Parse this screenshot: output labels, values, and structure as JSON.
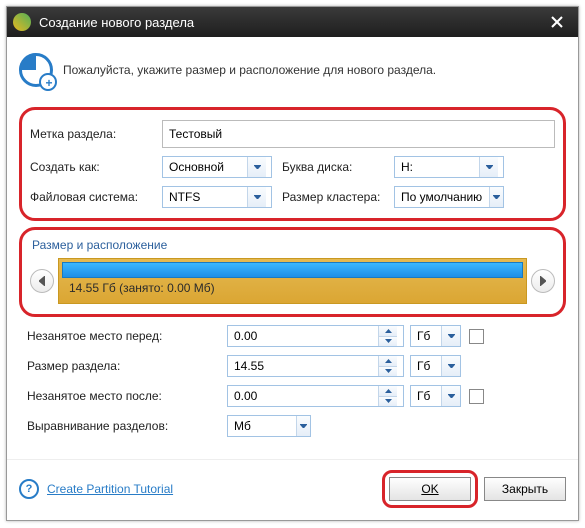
{
  "title": "Создание нового раздела",
  "intro": "Пожалуйста, укажите размер и расположение для нового раздела.",
  "labels": {
    "partition_label": "Метка раздела:",
    "create_as": "Создать как:",
    "drive_letter": "Буква диска:",
    "file_system": "Файловая система:",
    "cluster_size": "Размер кластера:",
    "group_title": "Размер и расположение",
    "free_before": "Незанятое место перед:",
    "partition_size": "Размер раздела:",
    "free_after": "Незанятое место после:",
    "alignment": "Выравнивание разделов:"
  },
  "values": {
    "partition_label": "Тестовый",
    "create_as": "Основной",
    "drive_letter": "H:",
    "file_system": "NTFS",
    "cluster_size": "По умолчанию",
    "bar_text": "14.55 Гб (занято: 0.00 Мб)",
    "free_before": "0.00",
    "partition_size": "14.55",
    "free_after": "0.00",
    "alignment": "Мб",
    "unit": "Гб"
  },
  "footer": {
    "tutorial": "Create Partition Tutorial",
    "ok": "OK",
    "close": "Закрыть"
  }
}
